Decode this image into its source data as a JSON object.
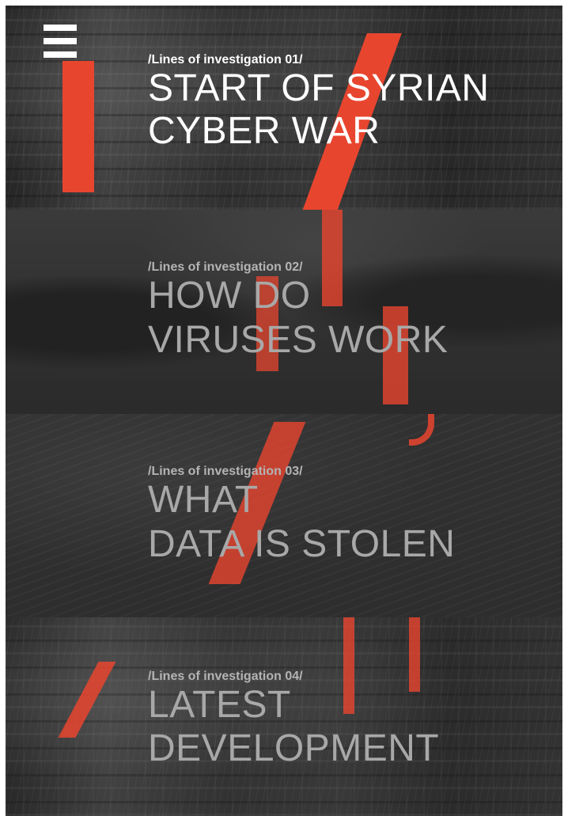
{
  "menu": {
    "icon": "hamburger-menu-icon"
  },
  "accent_color": "#e8452f",
  "investigations": [
    {
      "label": "/Lines of investigation 01/",
      "title_line1": "START OF SYRIAN",
      "title_line2": "CYBER WAR"
    },
    {
      "label": "/Lines of investigation 02/",
      "title_line1": "HOW DO",
      "title_line2": "VIRUSES WORK"
    },
    {
      "label": "/Lines of investigation 03/",
      "title_line1": "WHAT",
      "title_line2": "DATA IS STOLEN"
    },
    {
      "label": "/Lines of investigation 04/",
      "title_line1": "LATEST",
      "title_line2": "DEVELOPMENT"
    }
  ]
}
